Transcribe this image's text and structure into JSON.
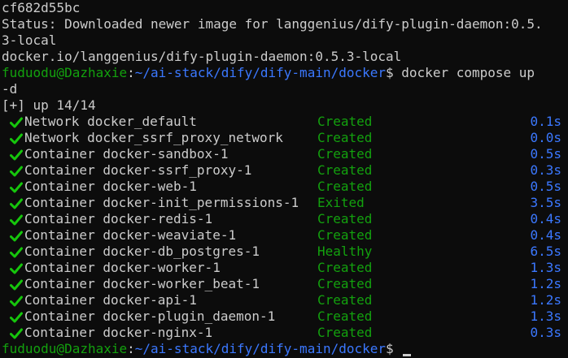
{
  "colors": {
    "background": "#0c0c0c",
    "text": "#cccccc",
    "prompt_user": "#13a10e",
    "prompt_path": "#3b78ff",
    "status_green": "#13a10e",
    "check_green": "#16c60c",
    "time_blue": "#3b78ff"
  },
  "output": {
    "line1": "cf682d55bc",
    "line2": "Status: Downloaded newer image for langgenius/dify-plugin-daemon:0.5.",
    "line3": "3-local",
    "line4": "docker.io/langgenius/dify-plugin-daemon:0.5.3-local"
  },
  "prompt1": {
    "user": "fuduodu@Dazhaxie",
    "sep": ":",
    "path": "~/ai-stack/dify/dify-main/docker",
    "symbol": "$ ",
    "command": "docker compose up",
    "command_wrap": "-d"
  },
  "summary": "[+] up 14/14",
  "check_icon": "checkmark-icon",
  "services": [
    {
      "name": "Network docker_default",
      "status": "Created",
      "time": "0.1s"
    },
    {
      "name": "Network docker_ssrf_proxy_network",
      "status": "Created",
      "time": "0.0s"
    },
    {
      "name": "Container docker-sandbox-1",
      "status": "Created",
      "time": "0.5s"
    },
    {
      "name": "Container docker-ssrf_proxy-1",
      "status": "Created",
      "time": "0.3s"
    },
    {
      "name": "Container docker-web-1",
      "status": "Created",
      "time": "0.5s"
    },
    {
      "name": "Container docker-init_permissions-1",
      "status": "Exited",
      "time": "3.5s"
    },
    {
      "name": "Container docker-redis-1",
      "status": "Created",
      "time": "0.4s"
    },
    {
      "name": "Container docker-weaviate-1",
      "status": "Created",
      "time": "0.4s"
    },
    {
      "name": "Container docker-db_postgres-1",
      "status": "Healthy",
      "time": "6.5s"
    },
    {
      "name": "Container docker-worker-1",
      "status": "Created",
      "time": "1.3s"
    },
    {
      "name": "Container docker-worker_beat-1",
      "status": "Created",
      "time": "1.2s"
    },
    {
      "name": "Container docker-api-1",
      "status": "Created",
      "time": "1.2s"
    },
    {
      "name": "Container docker-plugin_daemon-1",
      "status": "Created",
      "time": "1.3s"
    },
    {
      "name": "Container docker-nginx-1",
      "status": "Created",
      "time": "0.3s"
    }
  ],
  "prompt2": {
    "user": "fuduodu@Dazhaxie",
    "sep": ":",
    "path": "~/ai-stack/dify/dify-main/docker",
    "symbol": "$ "
  }
}
